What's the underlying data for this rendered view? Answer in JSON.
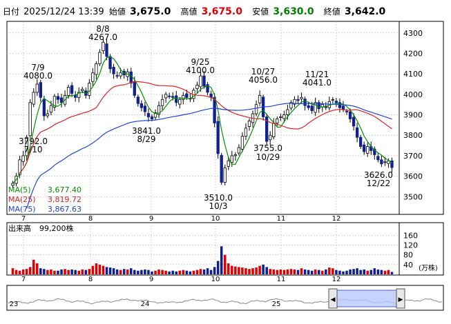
{
  "header": {
    "date_label": "日付",
    "datetime": "2025/12/24 13:39",
    "open_label": "始値",
    "open": "3,675.0",
    "high_label": "高値",
    "high": "3,675.0",
    "low_label": "安値",
    "low": "3,630.0",
    "close_label": "終値",
    "close": "3,642.0"
  },
  "legend": {
    "ma5_label": "MA(5)",
    "ma5": "3,677.40",
    "ma25_label": "MA(25)",
    "ma25": "3,819.72",
    "ma75_label": "MA(75)",
    "ma75": "3,867.63"
  },
  "volume_label": "出来高",
  "volume_value": "99,200株",
  "volume_unit": "(万株)",
  "colors": {
    "up": "#e00000",
    "down": "#102090",
    "ma5": "#009000",
    "ma25": "#e02020",
    "ma75": "#2040e0",
    "close": "#000000",
    "high_text": "#e00000",
    "low_text": "#008000"
  },
  "chart_data": {
    "type": "candlestick",
    "price_axis": {
      "ticks": [
        3500,
        3600,
        3700,
        3800,
        3900,
        4000,
        4100,
        4200,
        4300
      ],
      "range": [
        3420,
        4350
      ]
    },
    "volume_axis": {
      "ticks": [
        40,
        80,
        120,
        160
      ],
      "range": [
        0,
        175
      ]
    },
    "x_ticks": [
      "7",
      "8",
      "9",
      "10",
      "11",
      "12"
    ],
    "nav_ticks": [
      "23",
      "24",
      "25"
    ],
    "annotations": [
      {
        "label": "8/8",
        "value": "4267.0"
      },
      {
        "label": "7/9",
        "value": "4080.0"
      },
      {
        "label": "9/25",
        "value": "4100.0"
      },
      {
        "label": "10/27",
        "value": "4056.0"
      },
      {
        "label": "11/21",
        "value": "4041.0"
      },
      {
        "label": "3792.0",
        "value": "7/10"
      },
      {
        "label": "3841.0",
        "value": "8/29"
      },
      {
        "label": "3755.0",
        "value": "10/29"
      },
      {
        "label": "3510.0",
        "value": "10/3"
      },
      {
        "label": "3626.0",
        "value": "12/22"
      }
    ],
    "close": [
      3565,
      3600,
      3680,
      3700,
      3790,
      3960,
      4010,
      4050,
      3985,
      3895,
      3905,
      3945,
      3990,
      3975,
      3960,
      3995,
      4035,
      4005,
      3985,
      4010,
      4025,
      3995,
      4055,
      4105,
      4150,
      4205,
      4255,
      4185,
      4125,
      4100,
      4090,
      4105,
      4095,
      4110,
      4055,
      3995,
      3955,
      3935,
      3915,
      3890,
      3880,
      3910,
      3945,
      3975,
      4000,
      3990,
      3985,
      3960,
      3975,
      3995,
      3985,
      3980,
      4020,
      4045,
      4090,
      4040,
      4010,
      3985,
      3860,
      3710,
      3570,
      3640,
      3675,
      3700,
      3705,
      3740,
      3795,
      3835,
      3870,
      3905,
      3950,
      3995,
      3890,
      3770,
      3800,
      3860,
      3880,
      3890,
      3900,
      3925,
      3960,
      3975,
      3970,
      3985,
      3945,
      3935,
      3920,
      3960,
      3930,
      3950,
      3935,
      3965,
      3975,
      3960,
      3935,
      3925,
      3915,
      3880,
      3845,
      3790,
      3745,
      3720,
      3745,
      3725,
      3705,
      3680,
      3660,
      3670,
      3675,
      3642
    ],
    "volume": [
      25,
      18,
      15,
      20,
      22,
      30,
      60,
      45,
      25,
      22,
      18,
      20,
      15,
      15,
      20,
      22,
      18,
      20,
      18,
      15,
      20,
      18,
      22,
      35,
      45,
      40,
      35,
      30,
      28,
      25,
      20,
      18,
      22,
      20,
      25,
      18,
      15,
      18,
      20,
      18,
      12,
      15,
      20,
      18,
      15,
      12,
      15,
      12,
      15,
      18,
      15,
      12,
      15,
      18,
      22,
      20,
      25,
      18,
      30,
      55,
      115,
      80,
      45,
      35,
      32,
      30,
      28,
      25,
      22,
      25,
      28,
      35,
      40,
      30,
      22,
      20,
      18,
      20,
      18,
      20,
      22,
      20,
      18,
      25,
      20,
      18,
      15,
      20,
      18,
      15,
      20,
      28,
      25,
      18,
      15,
      12,
      15,
      20,
      22,
      25,
      18,
      20,
      15,
      18,
      25,
      20,
      18,
      15,
      18,
      10
    ]
  }
}
